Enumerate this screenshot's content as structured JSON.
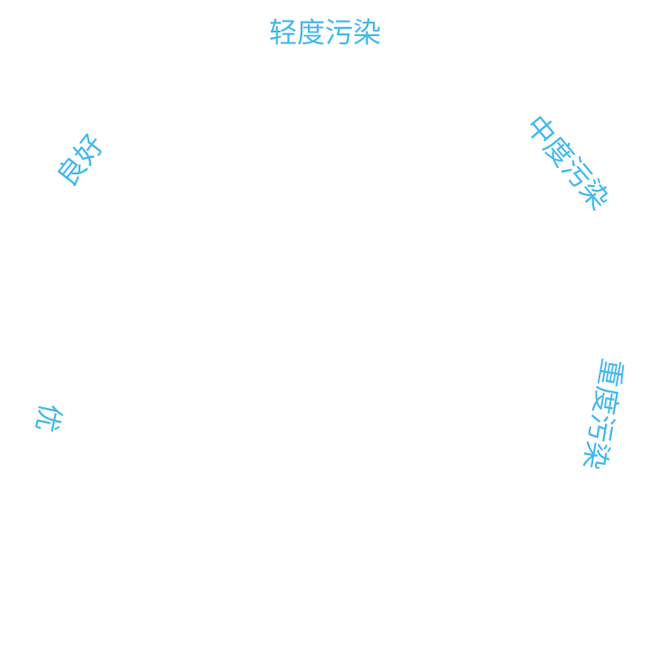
{
  "gauge": {
    "label_color": "#44B9EE",
    "levels": [
      {
        "key": "excellent",
        "label": "优"
      },
      {
        "key": "good",
        "label": "良好"
      },
      {
        "key": "light",
        "label": "轻度污染"
      },
      {
        "key": "moderate",
        "label": "中度污染"
      },
      {
        "key": "heavy",
        "label": "重度污染"
      }
    ]
  }
}
